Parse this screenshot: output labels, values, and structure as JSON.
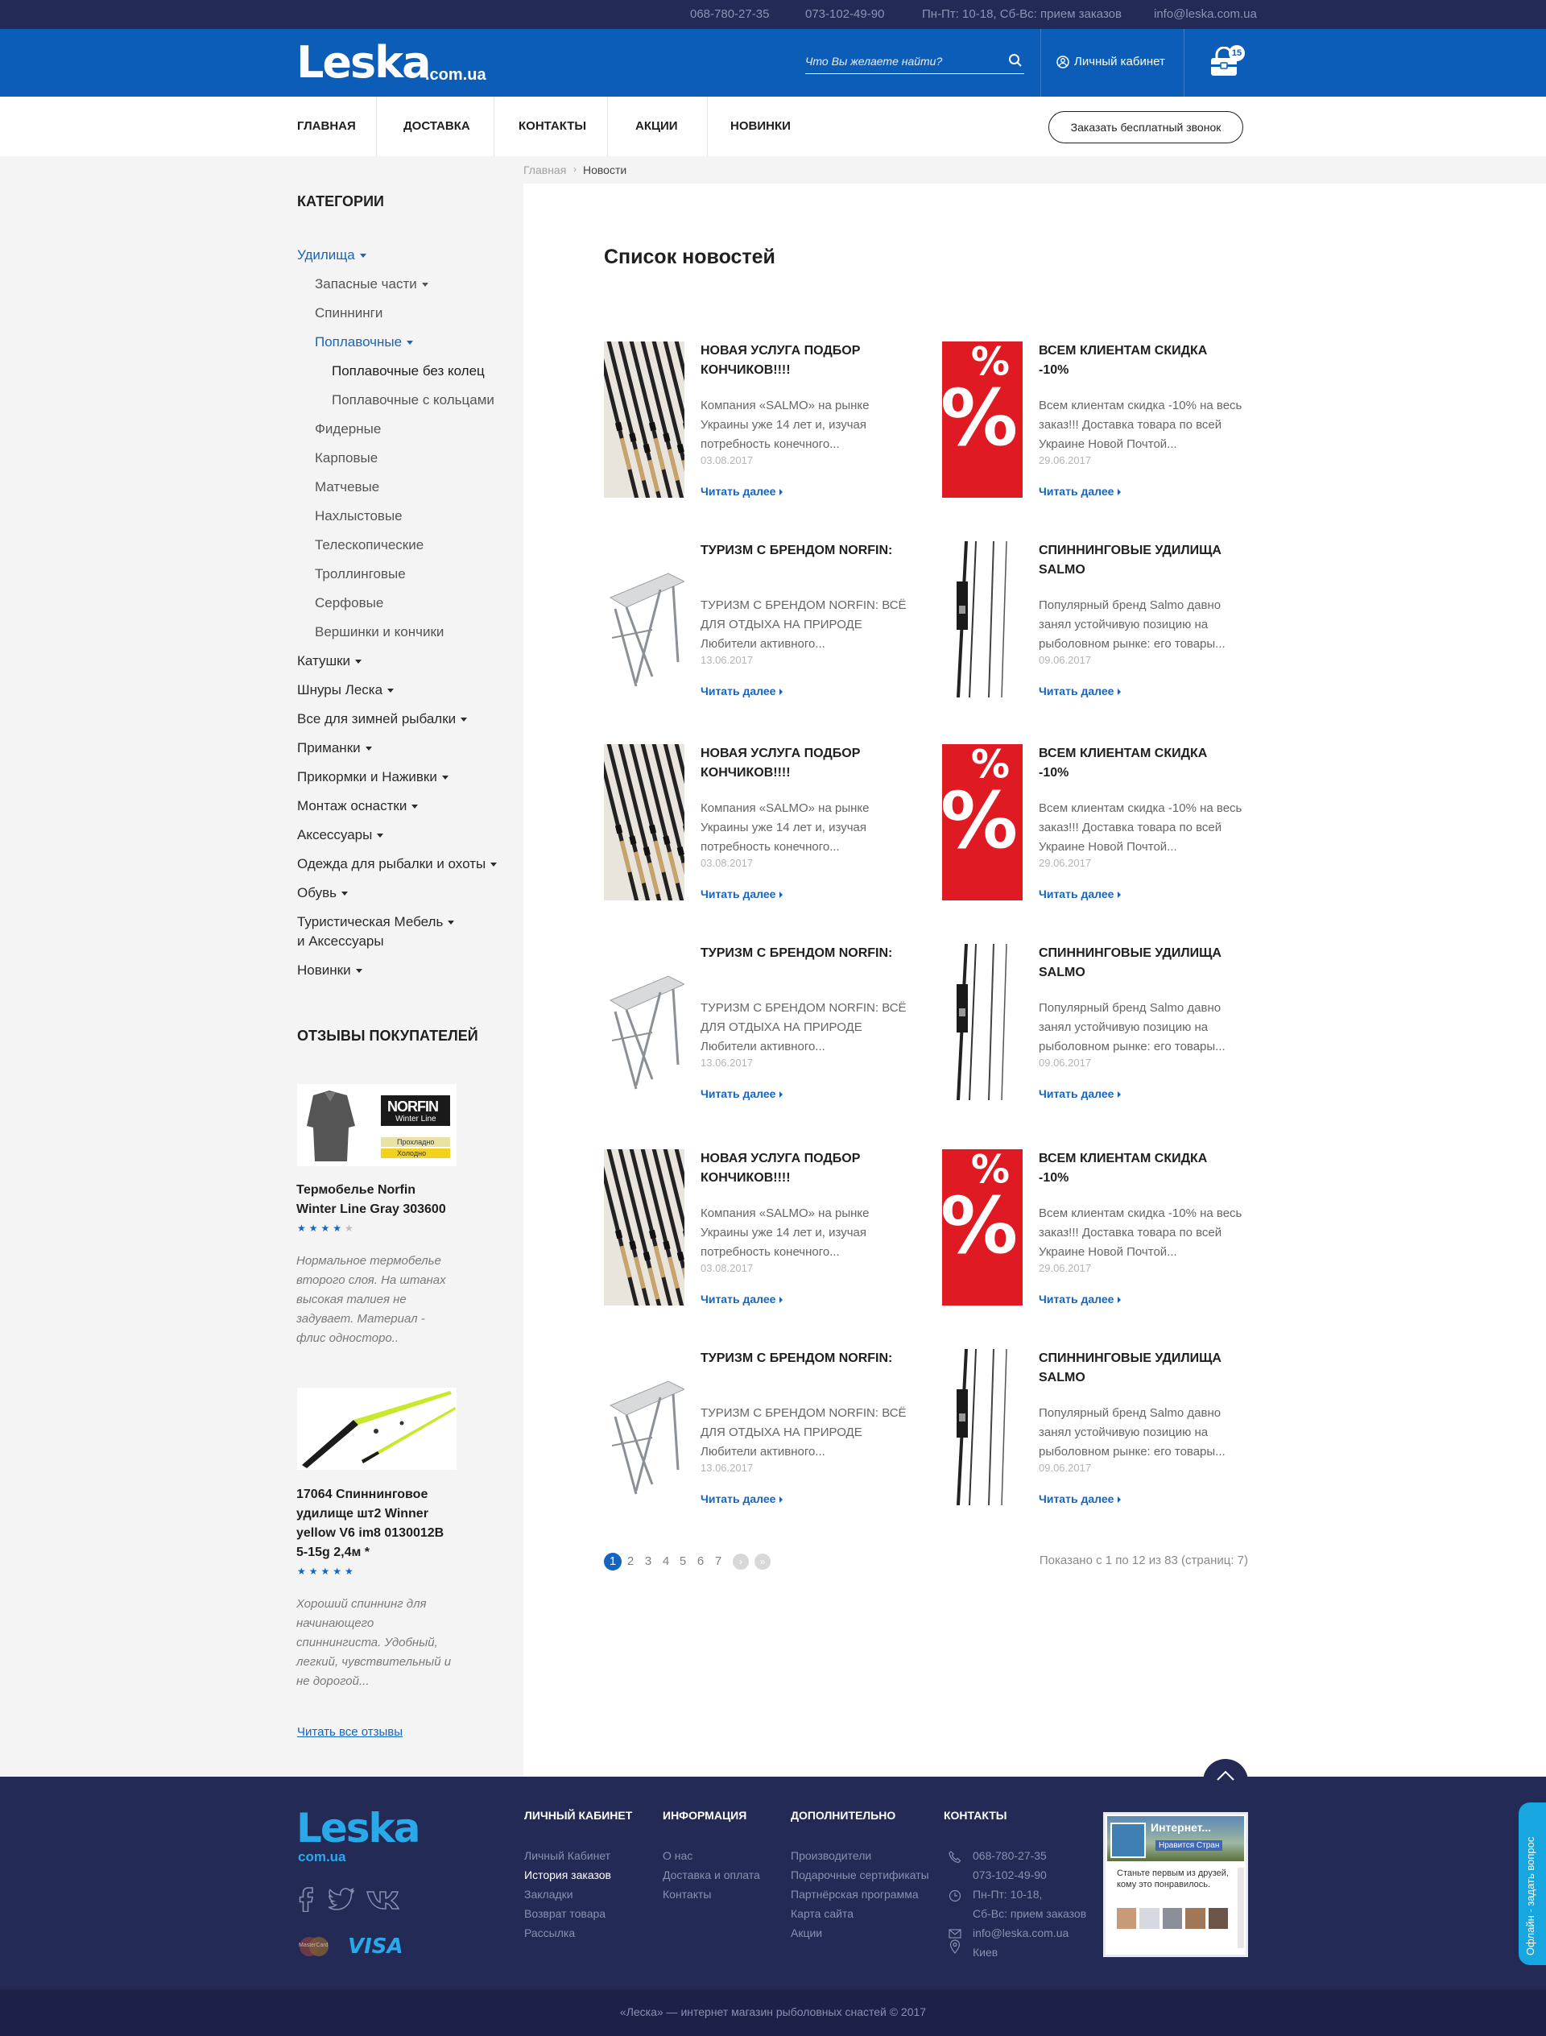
{
  "topbar": {
    "phone1": "068-780-27-35",
    "phone2": "073-102-49-90",
    "hours": "Пн-Пт: 10-18, Сб-Вс: прием заказов",
    "email": "info@leska.com.ua"
  },
  "header": {
    "logo": "Leska",
    "logo_sub": ".com.ua",
    "search_placeholder": "Что Вы желаете найти?",
    "account_label": "Личный кабинет",
    "cart_count": "15",
    "icons": [
      "search-icon",
      "user-icon",
      "cart-icon"
    ]
  },
  "nav": {
    "items": [
      "ГЛАВНАЯ",
      "ДОСТАВКА",
      "КОНТАКТЫ",
      "АКЦИИ",
      "НОВИНКИ"
    ],
    "callback_label": "Заказать бесплатный звонок"
  },
  "breadcrumb": {
    "home": "Главная",
    "current": "Новости"
  },
  "sidebar": {
    "categories_title": "КАТЕГОРИИ",
    "categories": [
      "Удилища",
      "Запасные части",
      "Спиннинги",
      "Поплавочные",
      "Поплавочные без колец",
      "Поплавочные с кольцами",
      "Фидерные",
      "Карповые",
      "Матчевые",
      "Нахлыстовые",
      "Телескопические",
      "Троллинговые",
      "Серфовые",
      "Вершинки и кончики",
      "Катушки",
      "Шнуры Леска",
      "Все для зимней рыбалки",
      "Приманки",
      "Прикормки и Наживки",
      "Монтаж оснастки",
      "Аксессуары",
      "Одежда для рыбалки и охоты",
      "Обувь",
      "Туристическая Мебель",
      "и Аксессуары",
      "Новинки"
    ],
    "reviews_title": "ОТЗЫВЫ ПОКУПАТЕЛЕЙ",
    "reviews": [
      {
        "title": "Термобелье Norfin Winter Line Gray 303600",
        "rating": 4,
        "text": "Нормальное термобелье второго слоя. На штанах высокая талиея не задувает. Материал - флис одностоpо..",
        "img_labels": [
          "NORFIN",
          "Winter Line",
          "Прохладно",
          "Холодно"
        ]
      },
      {
        "title": "17064 Спиннинговое удилище шт2 Winner yellow V6 im8 0130012B 5-15g 2,4м *",
        "rating": 5,
        "text": "Хороший спиннинг для начинающего спиннингиста. Удобный, легкий, чувствительный и не дорогой...",
        "img_labels": []
      }
    ],
    "all_reviews": "Читать все отзывы"
  },
  "main": {
    "title": "Список новостей",
    "read_more": "Читать далее",
    "news": [
      {
        "title": "НОВАЯ УСЛУГА ПОДБОР КОНЧИКОВ!!!!",
        "text": "Компания «SALMO» на рынке Украины уже 14 лет и, изучая потребность конечного...",
        "date": "03.08.2017",
        "img": "rods"
      },
      {
        "title": "ВСЕМ КЛИЕНТАМ СКИДКА -10%",
        "text": "Всем клиентам скидка -10% на весь заказ!!! Доставка товара по всей Украине Новой Почтой...",
        "date": "29.06.2017",
        "img": "percent"
      },
      {
        "title": "ТУРИЗМ С БРЕНДОМ NORFIN:",
        "text": "ТУРИЗМ С БРЕНДОМ NORFIN: ВСЁ ДЛЯ ОТДЫХА НА ПРИРОДЕ Любители активного...",
        "date": "13.06.2017",
        "img": "table"
      },
      {
        "title": "СПИННИНГОВЫЕ УДИЛИЩА SALMO",
        "text": "Популярный бренд Salmo давно занял устойчивую позицию на рыболовном рынке: его товары...",
        "date": "09.06.2017",
        "img": "spinning"
      },
      {
        "title": "НОВАЯ УСЛУГА ПОДБОР КОНЧИКОВ!!!!",
        "text": "Компания «SALMO» на рынке Украины уже 14 лет и, изучая потребность конечного...",
        "date": "03.08.2017",
        "img": "rods"
      },
      {
        "title": "ВСЕМ КЛИЕНТАМ СКИДКА -10%",
        "text": "Всем клиентам скидка -10% на весь заказ!!! Доставка товара по всей Украине Новой Почтой...",
        "date": "29.06.2017",
        "img": "percent"
      },
      {
        "title": "ТУРИЗМ С БРЕНДОМ NORFIN:",
        "text": "ТУРИЗМ С БРЕНДОМ NORFIN: ВСЁ ДЛЯ ОТДЫХА НА ПРИРОДЕ Любители активного...",
        "date": "13.06.2017",
        "img": "table"
      },
      {
        "title": "СПИННИНГОВЫЕ УДИЛИЩА SALMO",
        "text": "Популярный бренд Salmo давно занял устойчивую позицию на рыболовном рынке: его товары...",
        "date": "09.06.2017",
        "img": "spinning"
      },
      {
        "title": "НОВАЯ УСЛУГА ПОДБОР КОНЧИКОВ!!!!",
        "text": "Компания «SALMO» на рынке Украины уже 14 лет и, изучая потребность конечного...",
        "date": "03.08.2017",
        "img": "rods"
      },
      {
        "title": "ВСЕМ КЛИЕНТАМ СКИДКА -10%",
        "text": "Всем клиентам скидка -10% на весь заказ!!! Доставка товара по всей Украине Новой Почтой...",
        "date": "29.06.2017",
        "img": "percent"
      },
      {
        "title": "ТУРИЗМ С БРЕНДОМ NORFIN:",
        "text": "ТУРИЗМ С БРЕНДОМ NORFIN: ВСЁ ДЛЯ ОТДЫХА НА ПРИРОДЕ Любители активного...",
        "date": "13.06.2017",
        "img": "table"
      },
      {
        "title": "СПИННИНГОВЫЕ УДИЛИЩА SALMO",
        "text": "Популярный бренд Salmo давно занял устойчивую позицию на рыболовном рынке: его товары...",
        "date": "09.06.2017",
        "img": "spinning"
      }
    ],
    "pagination": {
      "pages": [
        "1",
        "2",
        "3",
        "4",
        "5",
        "6",
        "7"
      ],
      "current": "1",
      "next": "›",
      "last": "»",
      "info": "Показано с 1 по 12 из 83 (страниц: 7)"
    }
  },
  "footer": {
    "logo": "Leska",
    "logo_sub": "com.ua",
    "columns": [
      {
        "title": "ЛИЧНЫЙ КАБИНЕТ",
        "links": [
          "Личный Кабинет",
          "История заказов",
          "Закладки",
          "Возврат товара",
          "Рассылка"
        ]
      },
      {
        "title": "ИНФОРМАЦИЯ",
        "links": [
          "О нас",
          "Доставка и оплата",
          "Контакты"
        ]
      },
      {
        "title": "ДОПОЛНИТЕЛЬНО",
        "links": [
          "Производители",
          "Подарочные сертификаты",
          "Партнёрская программа",
          "Карта сайта",
          "Акции"
        ]
      },
      {
        "title": "КОНТАКТЫ",
        "links": [
          "068-780-27-35",
          "073-102-49-90",
          "Пн-Пт: 10-18,",
          "Сб-Вс: прием заказов",
          "info@leska.com.ua",
          "Киев"
        ]
      }
    ],
    "social_icons": [
      "facebook-icon",
      "twitter-icon",
      "vk-icon"
    ],
    "payment_icons": [
      "mastercard-icon",
      "visa-icon"
    ],
    "payment_labels": {
      "mastercard": "MasterCard",
      "visa": "VISA"
    },
    "fb_widget": {
      "title": "Интернет...",
      "like": "Нравится Стран",
      "text": "Станьте первым из друзей, кому это понравилось."
    },
    "copyright": "«Леска» — интернет магазин рыболовных снастей © 2017",
    "side_tab": "Офлайн - задать вопрос"
  },
  "colors": {
    "brand_blue": "#0b5db8",
    "link_blue": "#1565c0",
    "dark_navy": "#232a56",
    "accent_cyan": "#2aa9ea"
  }
}
